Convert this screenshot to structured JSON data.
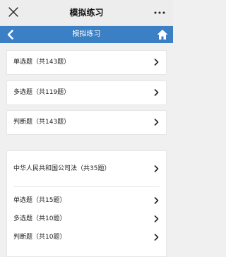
{
  "window": {
    "title": "模拟练习",
    "close_icon": "close-icon",
    "more_icon": "more-icon"
  },
  "navbar": {
    "title": "模拟练习",
    "back_icon": "chevron-left-icon",
    "home_icon": "home-icon",
    "bg_color": "#3b7fc4"
  },
  "practice_items": [
    {
      "label": "单选题（共143题）"
    },
    {
      "label": "多选题（共119题）"
    },
    {
      "label": "判断题（共143题）"
    }
  ],
  "law_section": {
    "title": "中华人民共和国公司法（共35题）",
    "items": [
      {
        "label": "单选题（共15题）"
      },
      {
        "label": "多选题（共10题）"
      },
      {
        "label": "判断题（共10题）"
      }
    ]
  }
}
